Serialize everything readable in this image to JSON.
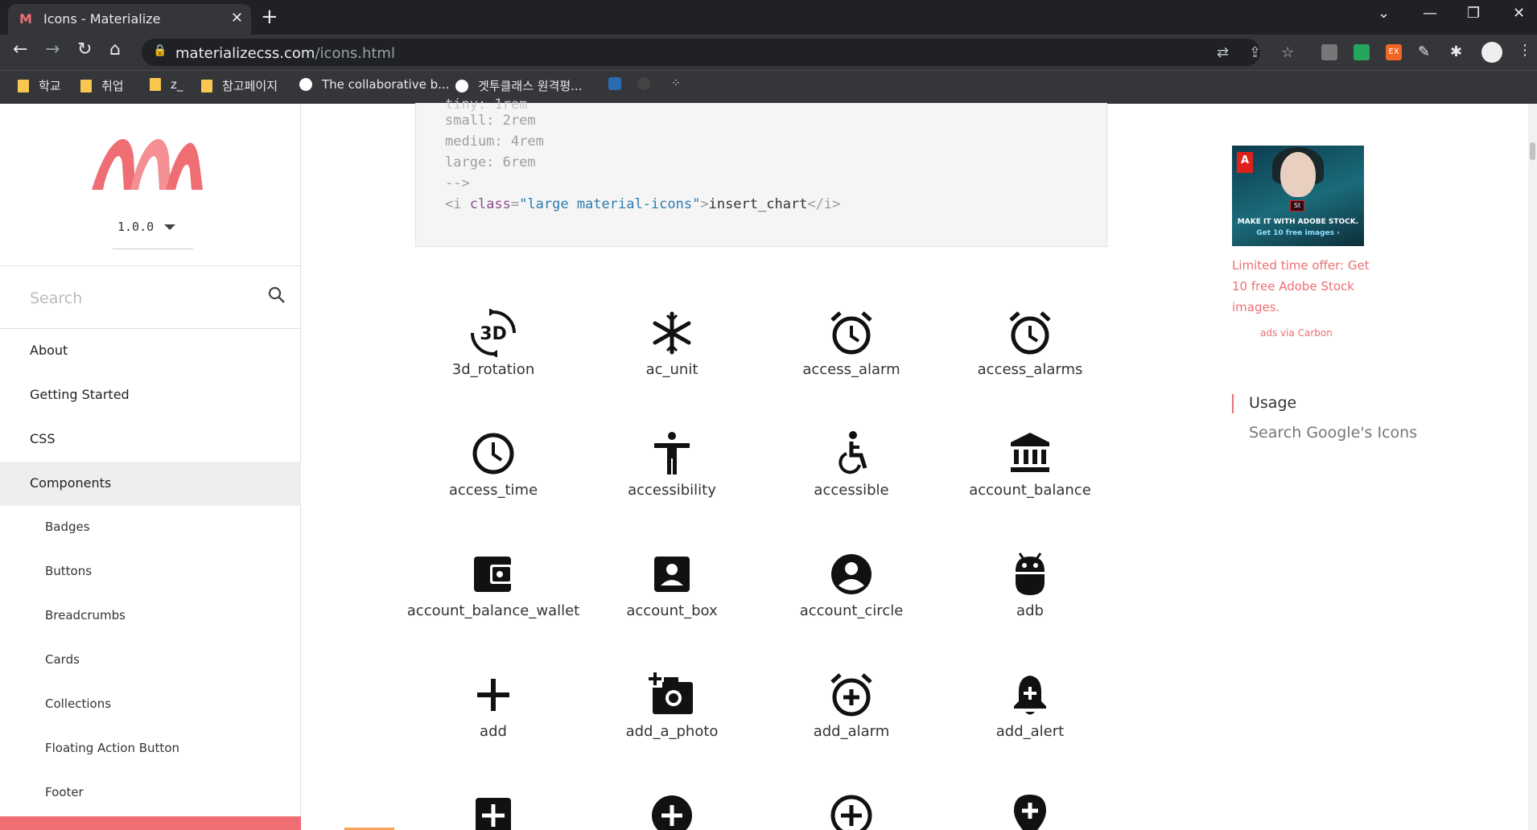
{
  "browser": {
    "tab_title": "Icons - Materialize",
    "url_domain": "materializecss.com",
    "url_path": "/icons.html",
    "bookmarks": [
      {
        "label": "학교",
        "icon": "folder-icon"
      },
      {
        "label": "취업",
        "icon": "folder-icon"
      },
      {
        "label": "z_",
        "icon": "folder-icon"
      },
      {
        "label": "참고페이지",
        "icon": "folder-icon"
      },
      {
        "label": "The collaborative b...",
        "icon": "site-icon"
      },
      {
        "label": "겟투클래스 원격평...",
        "icon": "globe-icon"
      }
    ]
  },
  "sidebar": {
    "version": "1.0.0",
    "search_placeholder": "Search",
    "nav": [
      {
        "label": "About"
      },
      {
        "label": "Getting Started"
      },
      {
        "label": "CSS"
      },
      {
        "label": "Components"
      }
    ],
    "sub_nav": [
      {
        "label": "Badges"
      },
      {
        "label": "Buttons"
      },
      {
        "label": "Breadcrumbs"
      },
      {
        "label": "Cards"
      },
      {
        "label": "Collections"
      },
      {
        "label": "Floating Action Button"
      },
      {
        "label": "Footer"
      }
    ]
  },
  "code": {
    "line1": "small: 2rem",
    "line2": "medium: 4rem",
    "line3": "large: 6rem",
    "line4": "-->",
    "tag_open": "<i",
    "attr": "class",
    "eq": "=",
    "value": "\"large material-icons\"",
    "close": ">",
    "text": "insert_chart",
    "tag_close": "</i>"
  },
  "icons": [
    {
      "name": "3d_rotation"
    },
    {
      "name": "ac_unit"
    },
    {
      "name": "access_alarm"
    },
    {
      "name": "access_alarms"
    },
    {
      "name": "access_time"
    },
    {
      "name": "accessibility"
    },
    {
      "name": "accessible"
    },
    {
      "name": "account_balance"
    },
    {
      "name": "account_balance_wallet"
    },
    {
      "name": "account_box"
    },
    {
      "name": "account_circle"
    },
    {
      "name": "adb"
    },
    {
      "name": "add"
    },
    {
      "name": "add_a_photo"
    },
    {
      "name": "add_alarm"
    },
    {
      "name": "add_alert"
    }
  ],
  "ad": {
    "banner_title": "MAKE IT WITH ADOBE STOCK.",
    "banner_sub": "Get 10 free images ›",
    "text": "Limited time offer: Get 10 free Adobe Stock images.",
    "via": "ads via Carbon"
  },
  "toc": {
    "usage": "Usage",
    "search": "Search Google's Icons"
  },
  "colors": {
    "accent": "#ee6e73",
    "chrome_dark": "#202124",
    "chrome_tab": "#35363a"
  }
}
